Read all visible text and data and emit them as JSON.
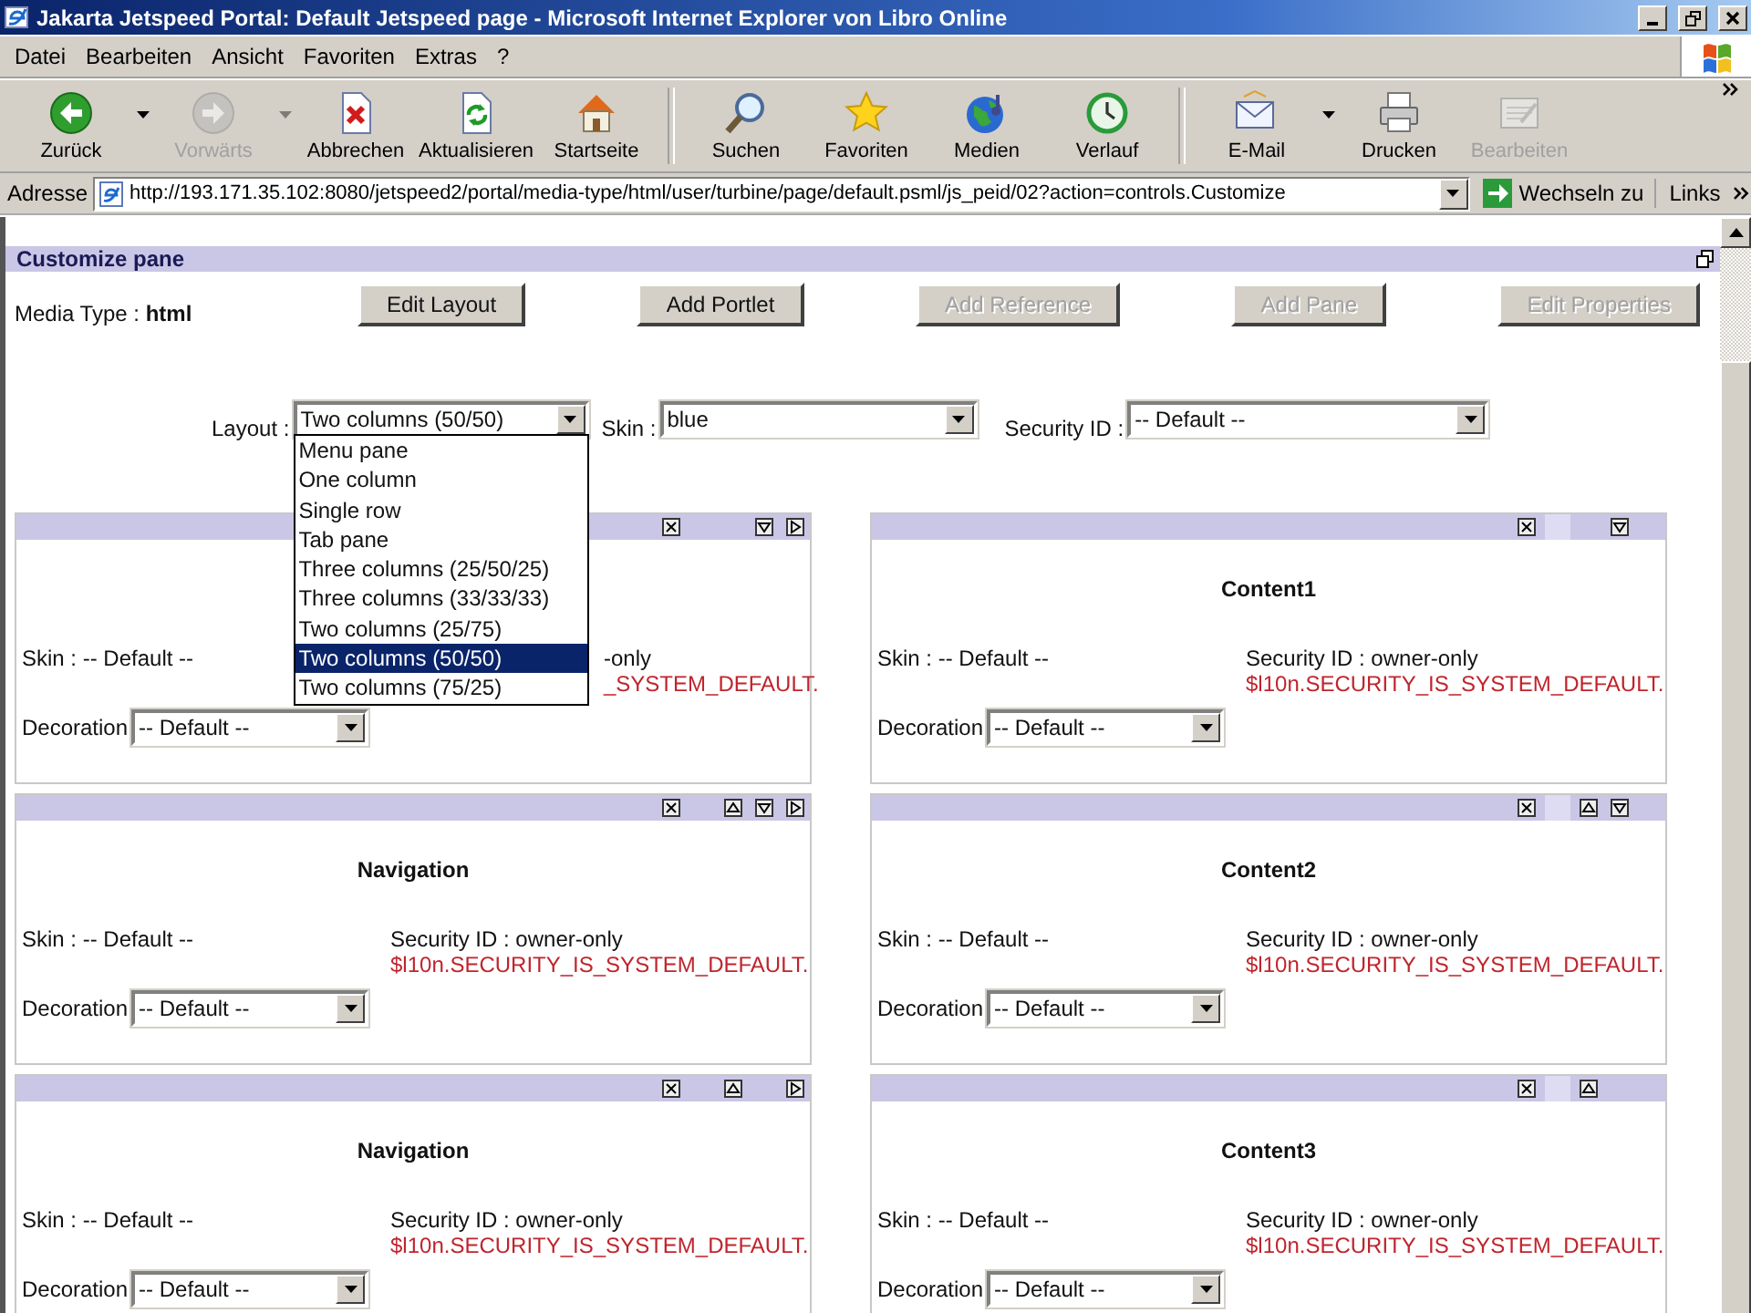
{
  "window": {
    "title": "Jakarta Jetspeed Portal: Default Jetspeed page - Microsoft Internet Explorer von Libro Online"
  },
  "menu": [
    "Datei",
    "Bearbeiten",
    "Ansicht",
    "Favoriten",
    "Extras",
    "?"
  ],
  "toolbar": [
    {
      "label": "Zurück",
      "kind": "back",
      "separator": false,
      "disabled": false,
      "dropdown": true
    },
    {
      "label": "Vorwärts",
      "kind": "forward",
      "separator": false,
      "disabled": true,
      "dropdown": true
    },
    {
      "label": "Abbrechen",
      "kind": "stop",
      "separator": false,
      "disabled": false,
      "dropdown": false
    },
    {
      "label": "Aktualisieren",
      "kind": "refresh",
      "separator": false,
      "disabled": false,
      "dropdown": false
    },
    {
      "label": "Startseite",
      "kind": "home",
      "separator": false,
      "disabled": false,
      "dropdown": false
    },
    {
      "label": "Suchen",
      "kind": "search",
      "separator": true,
      "disabled": false,
      "dropdown": false
    },
    {
      "label": "Favoriten",
      "kind": "favorites",
      "separator": false,
      "disabled": false,
      "dropdown": false
    },
    {
      "label": "Medien",
      "kind": "media",
      "separator": false,
      "disabled": false,
      "dropdown": false
    },
    {
      "label": "Verlauf",
      "kind": "history",
      "separator": false,
      "disabled": false,
      "dropdown": false
    },
    {
      "label": "E-Mail",
      "kind": "mail",
      "separator": true,
      "disabled": false,
      "dropdown": true
    },
    {
      "label": "Drucken",
      "kind": "print",
      "separator": false,
      "disabled": false,
      "dropdown": false
    },
    {
      "label": "Bearbeiten",
      "kind": "edit",
      "separator": false,
      "disabled": true,
      "dropdown": false
    }
  ],
  "address": {
    "label": "Adresse",
    "url": "http://193.171.35.102:8080/jetspeed2/portal/media-type/html/user/turbine/page/default.psml/js_peid/02?action=controls.Customize",
    "go": "Wechseln zu",
    "links": "Links"
  },
  "pane": {
    "title": "Customize pane",
    "media_type_label": "Media Type :",
    "media_type": "html",
    "buttons": [
      {
        "label": "Edit Layout",
        "disabled": false
      },
      {
        "label": "Add Portlet",
        "disabled": false
      },
      {
        "label": "Add Reference",
        "disabled": true
      },
      {
        "label": "Add Pane",
        "disabled": true
      },
      {
        "label": "Edit Properties",
        "disabled": true
      }
    ],
    "layout": {
      "label": "Layout :",
      "value": "Two columns (50/50)",
      "expanded": true,
      "options": [
        {
          "label": "Menu pane",
          "selected": false
        },
        {
          "label": "One column",
          "selected": false
        },
        {
          "label": "Single row",
          "selected": false
        },
        {
          "label": "Tab pane",
          "selected": false
        },
        {
          "label": "Three columns (25/50/25)",
          "selected": false
        },
        {
          "label": "Three columns (33/33/33)",
          "selected": false
        },
        {
          "label": "Two columns (25/75)",
          "selected": false
        },
        {
          "label": "Two columns (50/50)",
          "selected": true
        },
        {
          "label": "Two columns (75/25)",
          "selected": false
        }
      ]
    },
    "skin": {
      "label": "Skin :",
      "value": "blue"
    },
    "security": {
      "label": "Security ID :",
      "value": "-- Default --"
    }
  },
  "portlets": [
    {
      "kind": "covered",
      "controls": [
        {
          "kind": "close"
        },
        {
          "kind": "down"
        },
        {
          "kind": "right"
        }
      ],
      "skin": "Skin : -- Default --",
      "security": "-only",
      "security_note": "_SYSTEM_DEFAULT.",
      "decoration_label": "Decoration",
      "decoration": "-- Default --"
    },
    {
      "kind": "full",
      "title": "Navigation",
      "controls": [
        {
          "kind": "close"
        },
        {
          "kind": "up"
        },
        {
          "kind": "down"
        },
        {
          "kind": "right"
        }
      ],
      "skin": "Skin : -- Default --",
      "security": "Security ID : owner-only",
      "security_note": "$l10n.SECURITY_IS_SYSTEM_DEFAULT.",
      "decoration_label": "Decoration",
      "decoration": "-- Default --"
    },
    {
      "kind": "full",
      "title": "Navigation",
      "controls": [
        {
          "kind": "close"
        },
        {
          "kind": "up"
        },
        {
          "kind": "right"
        }
      ],
      "skin": "Skin : -- Default --",
      "security": "Security ID : owner-only",
      "security_note": "$l10n.SECURITY_IS_SYSTEM_DEFAULT.",
      "decoration_label": "Decoration",
      "decoration": "-- Default --"
    },
    {
      "kind": "full",
      "title": "Content1",
      "controls": [
        {
          "kind": "close"
        },
        {
          "kind": "blank"
        },
        {
          "kind": "down"
        }
      ],
      "skin": "Skin : -- Default --",
      "security": "Security ID : owner-only",
      "security_note": "$l10n.SECURITY_IS_SYSTEM_DEFAULT.",
      "decoration_label": "Decoration",
      "decoration": "-- Default --"
    },
    {
      "kind": "full",
      "title": "Content2",
      "controls": [
        {
          "kind": "close"
        },
        {
          "kind": "blank"
        },
        {
          "kind": "up"
        },
        {
          "kind": "down"
        }
      ],
      "skin": "Skin : -- Default --",
      "security": "Security ID : owner-only",
      "security_note": "$l10n.SECURITY_IS_SYSTEM_DEFAULT.",
      "decoration_label": "Decoration",
      "decoration": "-- Default --"
    },
    {
      "kind": "full",
      "title": "Content3",
      "controls": [
        {
          "kind": "close"
        },
        {
          "kind": "blank"
        },
        {
          "kind": "up"
        }
      ],
      "skin": "Skin : -- Default --",
      "security": "Security ID : owner-only",
      "security_note": "$l10n.SECURITY_IS_SYSTEM_DEFAULT.",
      "decoration_label": "Decoration",
      "decoration": "-- Default --"
    }
  ]
}
